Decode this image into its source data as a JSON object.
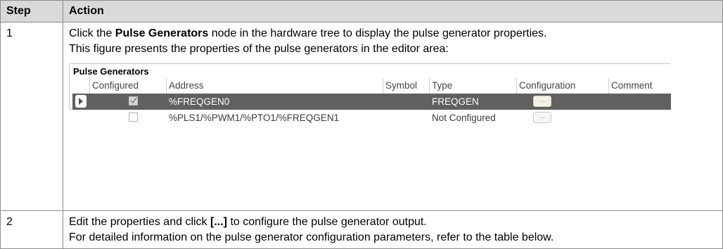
{
  "table": {
    "headers": [
      "Step",
      "Action"
    ],
    "rows": [
      {
        "step": "1",
        "line1_pre": "Click the ",
        "line1_bold": "Pulse Generators",
        "line1_post": " node in the hardware tree to display the pulse generator properties.",
        "line2": "This figure presents the properties of the pulse generators in the editor area:"
      },
      {
        "step": "2",
        "line1_pre": "Edit the properties and click ",
        "line1_bold": "[...]",
        "line1_post": " to configure the pulse generator output.",
        "line2": "For detailed information on the pulse generator configuration parameters, refer to the table below."
      }
    ]
  },
  "screenshot": {
    "title": "Pulse Generators",
    "columns": [
      "Configured",
      "Address",
      "Symbol",
      "Type",
      "Configuration",
      "Comment"
    ],
    "rows": [
      {
        "configured": true,
        "address": "%FREQGEN0",
        "symbol": "",
        "type": "FREQGEN",
        "button": "...",
        "selected": true
      },
      {
        "configured": false,
        "address": "%PLS1/%PWM1/%PTO1/%FREQGEN1",
        "symbol": "",
        "type": "Not Configured",
        "button": "...",
        "selected": false
      }
    ]
  }
}
